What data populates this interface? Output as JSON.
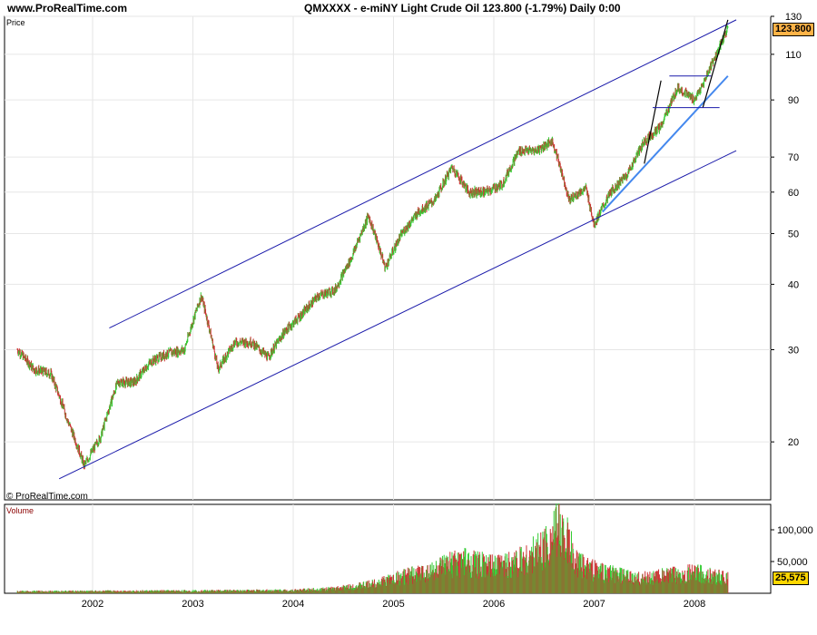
{
  "header": {
    "site": "www.ProRealTime.com",
    "title": "QMXXXX - e-miNY Light Crude Oil   123.800 (-1.79%)   Daily  0:00"
  },
  "price_panel": {
    "label": "Price",
    "copyright": "© ProRealTime.com",
    "last_value_label": "123.800"
  },
  "volume_panel": {
    "label": "Volume",
    "last_value_label": "25,575"
  },
  "colors": {
    "up_candle": "#33cc33",
    "down_candle": "#cc3333",
    "channel_line": "#1a1aaa",
    "trend_line": "#4488ee",
    "pattern_line": "#000000",
    "price_tag_bg": "#ffb347",
    "volume_tag_bg": "#ffd700",
    "panel_label": "#8b0000"
  },
  "chart_data": [
    {
      "type": "line",
      "title": "QMXXXX - e-miNY Light Crude Oil",
      "ylabel": "Price",
      "y_scale": "log",
      "ylim": [
        15.5,
        130
      ],
      "x_ticks": [
        "2002",
        "2003",
        "2004",
        "2005",
        "2006",
        "2007",
        "2008"
      ],
      "y_ticks": [
        20,
        30,
        40,
        50,
        60,
        70,
        90,
        110,
        130
      ],
      "y_tick_labels": [
        "20",
        "30",
        "40",
        "50",
        "60",
        "70",
        "90",
        "110",
        "130"
      ],
      "series": [
        {
          "values_by_date": [
            [
              "2001-04",
              30.0
            ],
            [
              "2001-06",
              27.5
            ],
            [
              "2001-08",
              27.0
            ],
            [
              "2001-10",
              22.0
            ],
            [
              "2001-12",
              18.0
            ],
            [
              "2002-02",
              20.5
            ],
            [
              "2002-04",
              26.0
            ],
            [
              "2002-06",
              26.0
            ],
            [
              "2002-08",
              28.5
            ],
            [
              "2002-10",
              29.5
            ],
            [
              "2002-12",
              30.0
            ],
            [
              "2003-02",
              38.0
            ],
            [
              "2003-04",
              27.5
            ],
            [
              "2003-06",
              31.0
            ],
            [
              "2003-08",
              31.0
            ],
            [
              "2003-10",
              29.0
            ],
            [
              "2003-12",
              32.5
            ],
            [
              "2004-02",
              35.0
            ],
            [
              "2004-04",
              38.0
            ],
            [
              "2004-06",
              39.0
            ],
            [
              "2004-08",
              45.0
            ],
            [
              "2004-10",
              54.0
            ],
            [
              "2004-12",
              43.0
            ],
            [
              "2005-02",
              50.0
            ],
            [
              "2005-04",
              55.0
            ],
            [
              "2005-06",
              58.0
            ],
            [
              "2005-08",
              67.0
            ],
            [
              "2005-10",
              60.0
            ],
            [
              "2005-12",
              60.0
            ],
            [
              "2006-02",
              62.0
            ],
            [
              "2006-04",
              72.0
            ],
            [
              "2006-06",
              72.0
            ],
            [
              "2006-08",
              75.0
            ],
            [
              "2006-10",
              58.0
            ],
            [
              "2006-12",
              61.0
            ],
            [
              "2007-01",
              52.0
            ],
            [
              "2007-03",
              60.0
            ],
            [
              "2007-05",
              65.0
            ],
            [
              "2007-07",
              75.0
            ],
            [
              "2007-09",
              80.0
            ],
            [
              "2007-11",
              95.0
            ],
            [
              "2008-01",
              90.0
            ],
            [
              "2008-02",
              96.0
            ],
            [
              "2008-03",
              105.0
            ],
            [
              "2008-04",
              113.0
            ],
            [
              "2008-05",
              123.8
            ]
          ]
        }
      ],
      "annotations": [
        {
          "type": "channel-upper",
          "from": [
            "2002-03",
            33.0
          ],
          "to": [
            "2008-06",
            128.0
          ]
        },
        {
          "type": "channel-lower",
          "from": [
            "2001-09",
            17.0
          ],
          "to": [
            "2008-06",
            72.0
          ]
        },
        {
          "type": "trendline",
          "from": [
            "2007-02",
            55.0
          ],
          "to": [
            "2008-05",
            100.0
          ]
        },
        {
          "type": "pattern",
          "from": [
            "2007-07",
            68.0
          ],
          "to": [
            "2007-09",
            98.0
          ]
        },
        {
          "type": "pattern",
          "from": [
            "2008-02",
            87.0
          ],
          "to": [
            "2008-05",
            128.0
          ]
        },
        {
          "type": "horizontal",
          "level": 87.0,
          "from": "2007-08",
          "to": "2008-04"
        },
        {
          "type": "horizontal",
          "level": 100.0,
          "from": "2007-10",
          "to": "2008-03"
        }
      ]
    },
    {
      "type": "bar",
      "title": "Volume",
      "ylim": [
        0,
        140000
      ],
      "y_ticks": [
        50000,
        100000
      ],
      "y_tick_labels": [
        "50,000",
        "100,000"
      ],
      "values_by_date": [
        [
          "2001-04",
          3000
        ],
        [
          "2002-01",
          3500
        ],
        [
          "2003-01",
          4000
        ],
        [
          "2004-01",
          5000
        ],
        [
          "2004-06",
          8000
        ],
        [
          "2004-10",
          15000
        ],
        [
          "2005-01",
          25000
        ],
        [
          "2005-06",
          40000
        ],
        [
          "2005-09",
          55000
        ],
        [
          "2006-01",
          45000
        ],
        [
          "2006-05",
          60000
        ],
        [
          "2006-07",
          80000
        ],
        [
          "2006-09",
          115000
        ],
        [
          "2006-11",
          50000
        ],
        [
          "2007-01",
          40000
        ],
        [
          "2007-06",
          25000
        ],
        [
          "2008-01",
          35000
        ],
        [
          "2008-05",
          25575
        ]
      ]
    }
  ]
}
